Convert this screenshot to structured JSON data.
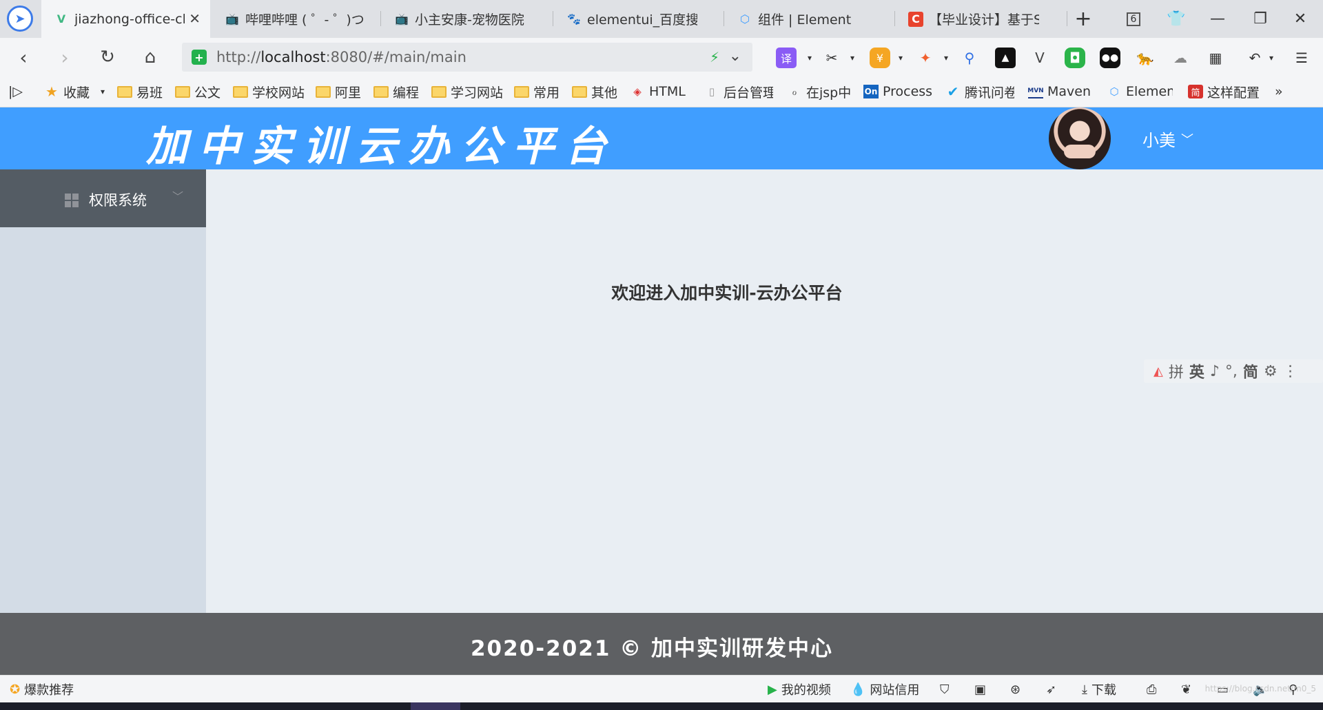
{
  "browser": {
    "tabs": [
      {
        "label": "jiazhong-office-cli",
        "icon": "vue-logo-icon",
        "active": true
      },
      {
        "label": "哔哩哔哩 ( ゜- ゜)つ",
        "icon": "bilibili-icon"
      },
      {
        "label": "小主安康-宠物医院",
        "icon": "bilibili-icon"
      },
      {
        "label": "elementui_百度搜索",
        "icon": "baidu-paw-icon"
      },
      {
        "label": "组件 | Element",
        "icon": "element-icon"
      },
      {
        "label": "【毕业设计】基于S",
        "icon": "csdn-icon"
      }
    ],
    "tab_count": "6",
    "url": {
      "protocol": "http://",
      "host": "localhost",
      "rest": ":8080/#/main/main"
    },
    "extensions": [
      "translate-icon",
      "scissors-icon",
      "wallet-icon",
      "game-icon",
      "search-icon",
      "ai-icon",
      "vivaldi-icon",
      "chat-icon",
      "bilibili-icon",
      "leopard-icon",
      "cloud-icon",
      "apps-icon",
      "undo-icon",
      "menu-icon"
    ],
    "extension_labels": {
      "translate": "译"
    },
    "bookmarks": [
      {
        "label": "收藏",
        "icon": "star-icon"
      },
      {
        "label": "易班",
        "icon": "folder-icon"
      },
      {
        "label": "公文",
        "icon": "folder-icon"
      },
      {
        "label": "学校网站",
        "icon": "folder-icon"
      },
      {
        "label": "阿里",
        "icon": "folder-icon"
      },
      {
        "label": "编程",
        "icon": "folder-icon"
      },
      {
        "label": "学习网站",
        "icon": "folder-icon"
      },
      {
        "label": "常用",
        "icon": "folder-icon"
      },
      {
        "label": "其他",
        "icon": "folder-icon"
      },
      {
        "label": "HTML",
        "icon": "html-icon"
      },
      {
        "label": "后台管理",
        "icon": "page-icon"
      },
      {
        "label": "在jsp中",
        "icon": "link-icon"
      },
      {
        "label": "Process",
        "icon": "on-icon"
      },
      {
        "label": "腾讯问卷",
        "icon": "check-icon"
      },
      {
        "label": "Maven",
        "icon": "mvn-icon"
      },
      {
        "label": "Element",
        "icon": "element-icon"
      },
      {
        "label": "这样配置",
        "icon": "jian-icon"
      }
    ],
    "bookmark_icons": {
      "on": "On",
      "mvn": "MVN",
      "jian": "简"
    },
    "more_label": "»"
  },
  "app": {
    "title": "加中实训云办公平台",
    "user_name": "小美",
    "sidebar": {
      "items": [
        {
          "label": "权限系统"
        }
      ]
    },
    "welcome": "欢迎进入加中实训-云办公平台",
    "footer": "2020-2021 © 加中实训研发中心",
    "ime_bar": [
      "拼",
      "英",
      "♪",
      "°,",
      "简",
      "⚙",
      "⋮"
    ]
  },
  "statusbar": {
    "left": "爆款推荐",
    "items": [
      "我的视频",
      "网站信用",
      "下载"
    ],
    "watermark": "https://blog.csdn.net/m0_5"
  },
  "colors": {
    "header": "#409eff",
    "sidebar": "#d3dce6",
    "menu": "#545c64",
    "main": "#e9eef3",
    "footer": "#5e6063"
  }
}
